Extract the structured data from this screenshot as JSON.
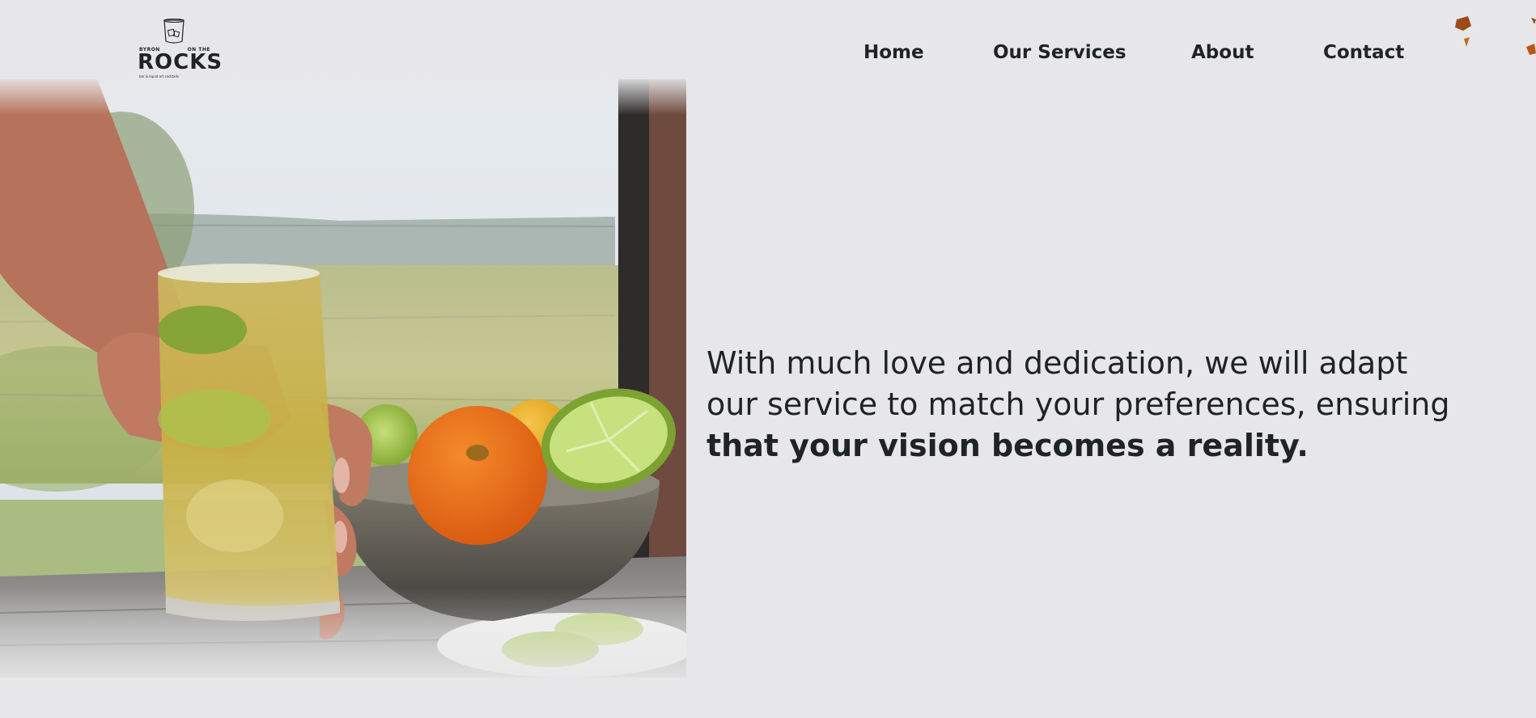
{
  "brand": {
    "tag_left": "BYRON",
    "tag_right": "ON THE",
    "wordmark": "ROCKS",
    "tagline": "bar & liquid art cocktails",
    "logo_icon": "whisky-glass-icon"
  },
  "nav": {
    "items": [
      {
        "label": "Home"
      },
      {
        "label": "Our Services"
      },
      {
        "label": "About"
      },
      {
        "label": "Contact"
      }
    ]
  },
  "hero": {
    "text_regular": "With much love and dedication, we will adapt our service to match your preferences, ensuring ",
    "text_bold": "that your vision becomes a reality.",
    "image_subject": "hand holding an iced drink with lime beside a bowl of citrus fruit"
  },
  "colors": {
    "background": "#e7e7e9",
    "text": "#1f2326",
    "accent_orange": "#b8571a"
  }
}
